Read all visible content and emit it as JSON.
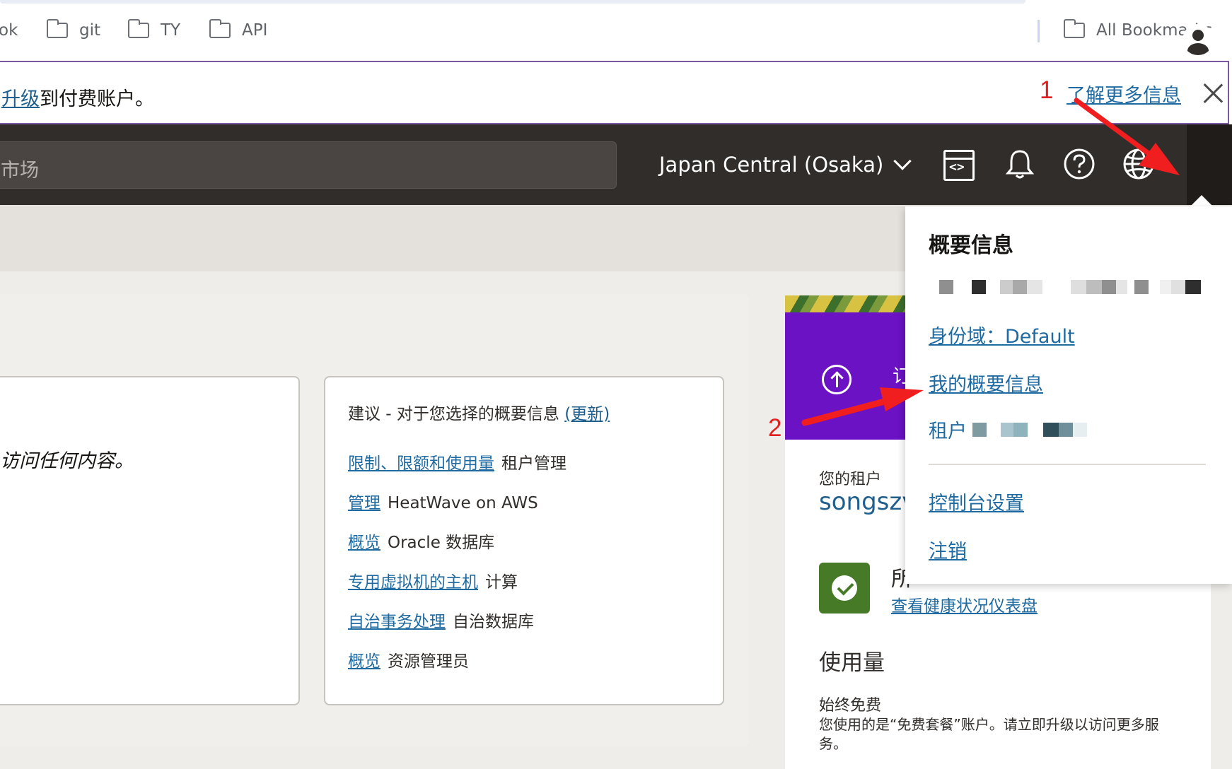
{
  "bookmarks": {
    "items": [
      {
        "label": "ok"
      },
      {
        "label": "git"
      },
      {
        "label": "TY"
      },
      {
        "label": "API"
      }
    ],
    "all_label": "All Bookmarks"
  },
  "announcement": {
    "link_partial": "升级",
    "text": "到付费账户。",
    "learn_more": "了解更多信息"
  },
  "header": {
    "search_partial": "市场",
    "region": "Japan Central (Osaka)",
    "icons": [
      "code-editor-icon",
      "bell-icon",
      "help-icon",
      "globe-icon",
      "user-avatar-icon"
    ]
  },
  "main": {
    "card1_partial": "访问任何内容。",
    "recommendations": {
      "title": "建议 - 对于您选择的概要信息",
      "refresh": "(更新)",
      "items": [
        {
          "link": "限制、限额和使用量",
          "text": "租户管理"
        },
        {
          "link": "管理",
          "text": "HeatWave on AWS"
        },
        {
          "link": "概览",
          "text": "Oracle 数据库"
        },
        {
          "link": "专用虚拟机的主机",
          "text": "计算"
        },
        {
          "link": "自治事务处理",
          "text": "自治数据库"
        },
        {
          "link": "概览",
          "text": "资源管理员"
        }
      ]
    }
  },
  "side": {
    "banner_peek": "订",
    "tenancy_label": "您的租户",
    "tenancy_name": "songszv",
    "health_peek": "所",
    "health_link": "查看健康状况仪表盘",
    "usage_title": "使用量",
    "usage_sub": "始终免费",
    "usage_desc": "您使用的是“免费套餐”账户。请立即升级以访问更多服务。"
  },
  "profile_menu": {
    "title": "概要信息",
    "identity_domain": "身份域：Default",
    "my_profile": "我的概要信息",
    "tenancy": "租户",
    "console_settings": "控制台设置",
    "sign_out": "注销"
  },
  "annotations": {
    "step1": "1",
    "step2": "2",
    "color": "#e02020"
  }
}
